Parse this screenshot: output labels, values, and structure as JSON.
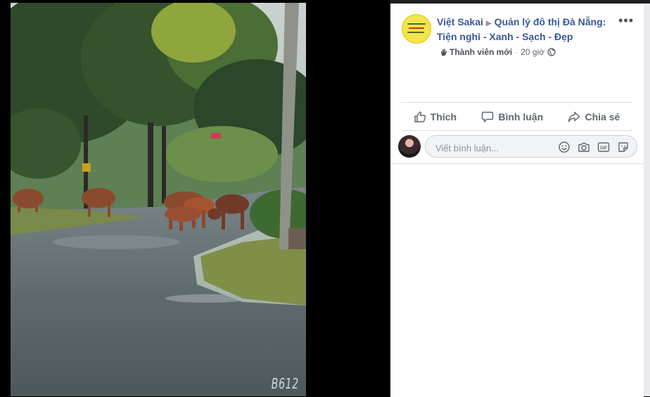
{
  "post": {
    "author": "Việt Sakai",
    "group": "Quản lý đô thị Đà Nẵng: Tiện nghi - Xanh - Sạch - Đẹp",
    "badge": "Thành viên mới",
    "time": "20 giờ",
    "more": "•••"
  },
  "photo": {
    "watermark": "B612"
  },
  "actions": {
    "like": "Thích",
    "comment": "Bình luận",
    "share": "Chia sẻ"
  },
  "comment_box": {
    "placeholder": "Viết bình luận..."
  },
  "icons": {
    "more": "more-dots-icon",
    "like": "thumbs-up-icon",
    "comment": "speech-bubble-icon",
    "share": "share-arrow-icon",
    "privacy": "globe-icon",
    "badge": "wave-hand-icon",
    "emoji": "smiley-icon",
    "camera": "camera-icon",
    "gif": "gif-icon",
    "sticker": "sticker-icon"
  }
}
